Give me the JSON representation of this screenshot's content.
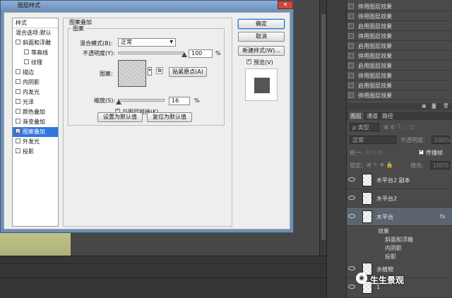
{
  "dialog": {
    "title": "图层样式",
    "close": "✕",
    "styles_header": "样式",
    "blend_options": "混合选项:默认",
    "styles": [
      {
        "label": "斜面和浮雕",
        "checked": false,
        "indent": false,
        "selected": false
      },
      {
        "label": "等高线",
        "checked": false,
        "indent": true,
        "selected": false
      },
      {
        "label": "纹理",
        "checked": false,
        "indent": true,
        "selected": false
      },
      {
        "label": "描边",
        "checked": false,
        "indent": false,
        "selected": false
      },
      {
        "label": "内阴影",
        "checked": false,
        "indent": false,
        "selected": false
      },
      {
        "label": "内发光",
        "checked": false,
        "indent": false,
        "selected": false
      },
      {
        "label": "光泽",
        "checked": false,
        "indent": false,
        "selected": false
      },
      {
        "label": "颜色叠加",
        "checked": false,
        "indent": false,
        "selected": false
      },
      {
        "label": "渐变叠加",
        "checked": false,
        "indent": false,
        "selected": false
      },
      {
        "label": "图案叠加",
        "checked": true,
        "indent": false,
        "selected": true
      },
      {
        "label": "外发光",
        "checked": false,
        "indent": false,
        "selected": false
      },
      {
        "label": "投影",
        "checked": false,
        "indent": false,
        "selected": false
      }
    ],
    "section_title": "图案叠加",
    "group_title": "图案",
    "blend_mode_label": "混合模式(B):",
    "blend_mode_value": "正常",
    "opacity_label": "不透明度(Y):",
    "opacity_value": "100",
    "opacity_unit": "%",
    "opacity_fraction": 1.0,
    "pattern_label": "图案:",
    "snap_origin": "贴紧原点(A)",
    "scale_label": "缩放(S):",
    "scale_value": "16",
    "scale_unit": "%",
    "scale_fraction": 0.016,
    "link_label": "与图层链接(K)",
    "link_checked": true,
    "set_default": "设置为默认值",
    "reset_default": "复位为默认值",
    "ok": "确定",
    "cancel": "取消",
    "new_style": "新建样式(W)...",
    "preview_label": "预览(V)",
    "preview_checked": true
  },
  "history": {
    "items": [
      "停用图层效果",
      "停用图层效果",
      "启用图层效果",
      "停用图层效果",
      "启用图层效果",
      "停用图层效果",
      "启用图层效果",
      "停用图层效果",
      "启用图层效果",
      "停用图层效果"
    ]
  },
  "layers_panel": {
    "tabs": [
      "图层",
      "通道",
      "路径"
    ],
    "active_tab": 0,
    "kind_label": "ρ 类型",
    "blend_value": "正常",
    "opacity_label": "不透明度:",
    "opacity_value": "100%",
    "unify_label": "统一:",
    "propagate_label": "传播帧",
    "lock_label": "锁定:",
    "fill_label": "填充:",
    "fill_value": "100%",
    "layers": [
      {
        "name": "木平台2 副本",
        "selected": false
      },
      {
        "name": "木平台2",
        "selected": false
      },
      {
        "name": "木平台",
        "selected": true,
        "fx": "fx"
      },
      {
        "name": "水植物",
        "selected": false
      },
      {
        "name": "1",
        "selected": false
      }
    ],
    "effects_label": "效果",
    "effects": [
      "斜面和浮雕",
      "内阴影",
      "投影"
    ]
  },
  "watermark": "生生景观"
}
